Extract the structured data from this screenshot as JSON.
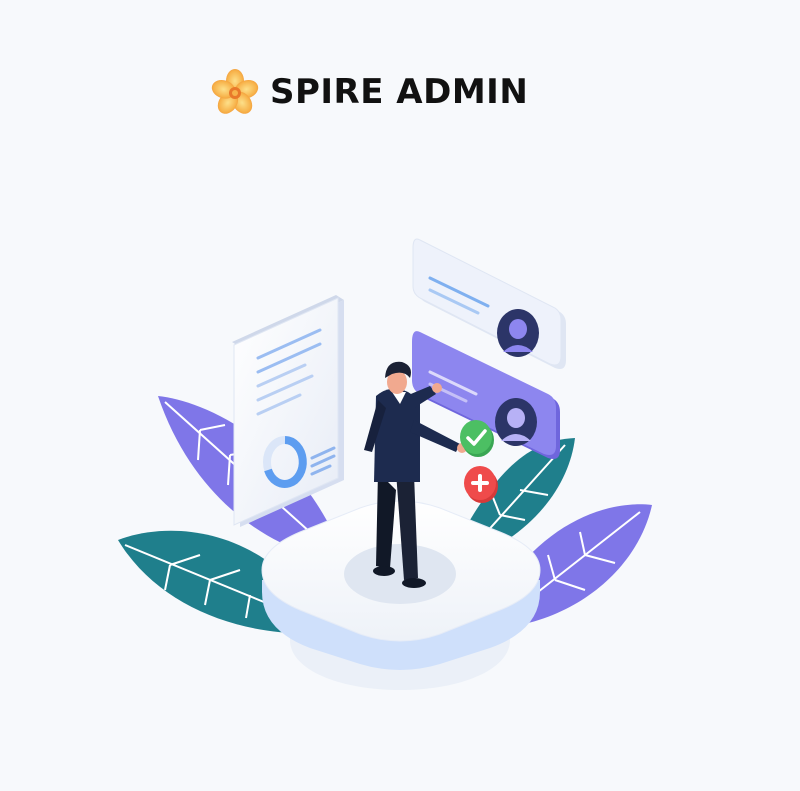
{
  "brand": {
    "name": "SPIRE ADMIN",
    "logo_icon": "flower-icon",
    "logo_colors": [
      "#f4a23a",
      "#fbc95d",
      "#e9792a"
    ]
  },
  "illustration": {
    "subject": "admin-approval-illustration",
    "colors": {
      "background": "#f7f9fc",
      "leaf_purple": "#7f76e8",
      "leaf_teal": "#1f7f8c",
      "card_light": "#eef2fb",
      "card_purple": "#8d86ef",
      "accent_blue": "#5d9df0",
      "suit_navy": "#1d2b4f",
      "approve_green": "#4cbf63",
      "reject_red": "#ef4b4b"
    }
  }
}
